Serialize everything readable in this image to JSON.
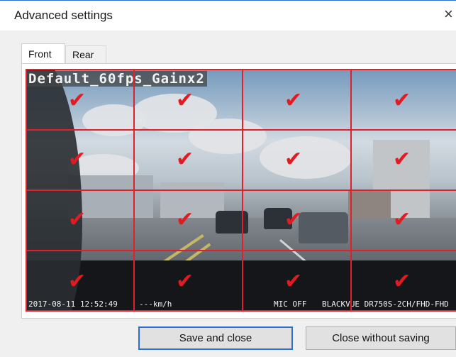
{
  "window": {
    "title": "Advanced settings",
    "close_glyph": "×"
  },
  "tabs": [
    {
      "label": "Front",
      "selected": true
    },
    {
      "label": "Rear",
      "selected": false
    }
  ],
  "preview": {
    "overlay_top": "Default_60fps_Gainx2",
    "overlay_bottom": {
      "datetime": "2017-08-11 12:52:49",
      "speed": "---km/h",
      "mic": "MIC OFF",
      "model": "BLACKVUE DR750S-2CH/FHD-FHD"
    },
    "grid": {
      "rows": 4,
      "cols": 4,
      "check_glyph": "✔",
      "checked": [
        true,
        true,
        true,
        true,
        true,
        true,
        true,
        true,
        true,
        true,
        true,
        true,
        true,
        true,
        true,
        true
      ]
    }
  },
  "buttons": {
    "save_label": "Save and close",
    "close_label": "Close without saving"
  },
  "colors": {
    "grid_line": "#e0202a",
    "check": "#e31a22",
    "primary_border": "#2f6fd0"
  }
}
